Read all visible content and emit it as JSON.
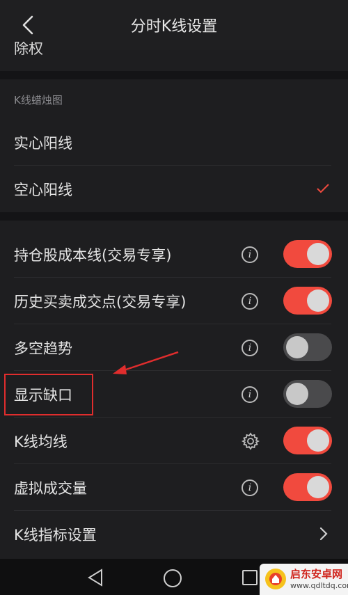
{
  "header": {
    "title": "分时K线设置"
  },
  "partial_item": {
    "label": "除权"
  },
  "candle_section": {
    "label": "K线蜡烛图",
    "options": [
      {
        "label": "实心阳线",
        "selected": false
      },
      {
        "label": "空心阳线",
        "selected": true
      }
    ]
  },
  "settings": [
    {
      "label": "持仓股成本线(交易专享)",
      "icon": "info-icon",
      "enabled": true
    },
    {
      "label": "历史买卖成交点(交易专享)",
      "icon": "info-icon",
      "enabled": true
    },
    {
      "label": "多空趋势",
      "icon": "info-icon",
      "enabled": false
    },
    {
      "label": "显示缺口",
      "icon": "info-icon",
      "enabled": false
    },
    {
      "label": "K线均线",
      "icon": "gear-icon",
      "enabled": true
    },
    {
      "label": "虚拟成交量",
      "icon": "info-icon",
      "enabled": true
    }
  ],
  "indicator_settings": {
    "label": "K线指标设置"
  },
  "info_glyph": "i",
  "colors": {
    "accent": "#f14a3e",
    "highlight": "#e02d2d",
    "background": "#1e1e20"
  },
  "watermark": {
    "name": "启东安卓网",
    "url": "www.qdltdq.com"
  }
}
